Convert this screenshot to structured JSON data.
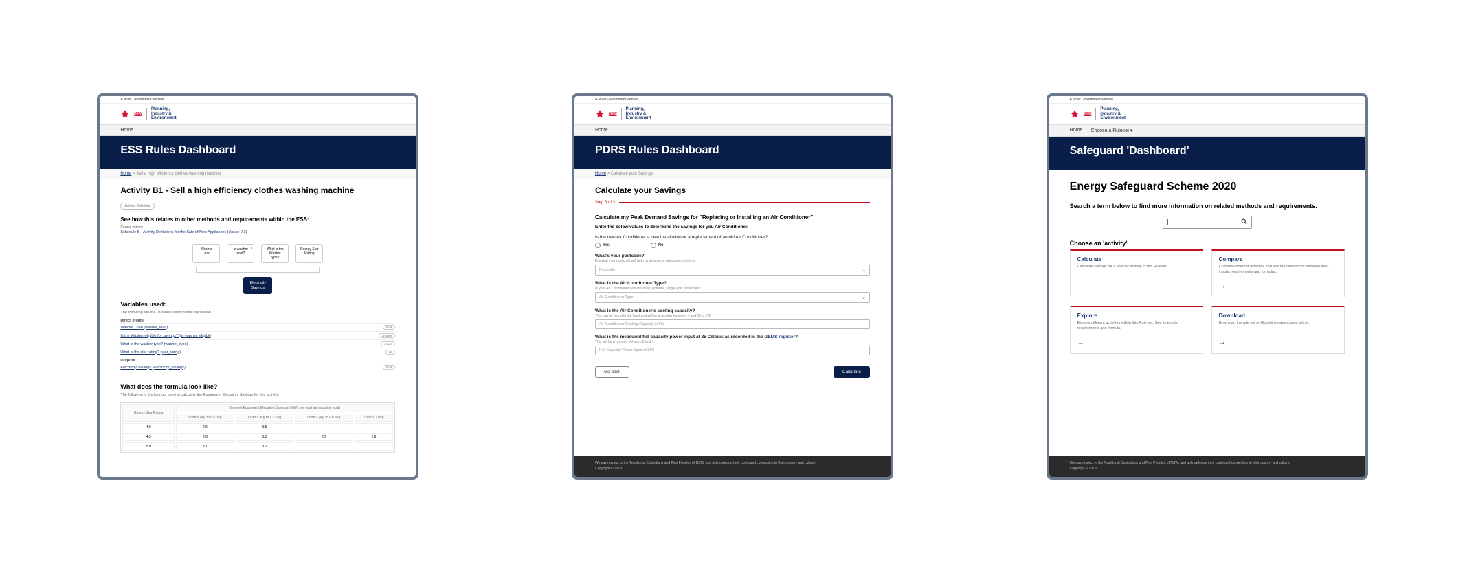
{
  "gov_label": "A NSW Government website",
  "brand_lines": {
    "l1": "Planning,",
    "l2": "Industry &",
    "l3": "Environment"
  },
  "nsw": "NSW",
  "footer": {
    "ack": "We pay respect to the Traditional Custodians and First Peoples of NSW, and acknowledge their continued connection to their country and culture.",
    "copyright": "Copyright © 2019"
  },
  "card1": {
    "nav": {
      "home": "Home"
    },
    "title": "ESS Rules Dashboard",
    "breadcrumb_home": "Home",
    "breadcrumb_sep": " > ",
    "breadcrumb_current": "Sell a high efficiency clothes washing machine",
    "activity_heading": "Activity B1 - Sell a high efficiency clothes washing machine",
    "activity_badge": "Activity Definition",
    "relates": "See how this relates to other methods and requirements within the ESS:",
    "found_within": "Found within:",
    "schedule": "Schedule B - Activity Definitions for the Sale of New Appliances (clause 9.3)",
    "flow": [
      {
        "label": "Washer",
        "sub": "Load"
      },
      {
        "label": "Is washer",
        "sub": "sold?"
      },
      {
        "label": "What is the",
        "sub": "Washer type?"
      },
      {
        "label": "Energy Star",
        "sub": "Rating"
      }
    ],
    "flow_target": "Electricity Savings",
    "vars_heading": "Variables used:",
    "vars_intro": "The following are the variables used in this calculation.",
    "direct_inputs_label": "Direct inputs",
    "direct_inputs": [
      {
        "name": "Washer Load (washer_load)",
        "tag": "float"
      },
      {
        "name": "Is the Washer eligible for savings? (is_washer_eligible)",
        "tag": "answer"
      },
      {
        "name": "What is the washer type? (washer_type)",
        "tag": "enum"
      },
      {
        "name": "What is the star rating? (star_rating)",
        "tag": "int"
      }
    ],
    "outputs_label": "Outputs",
    "outputs": [
      {
        "name": "Electricity Savings (electricity_savings)",
        "tag": "float"
      }
    ],
    "formula_heading": "What does the formula look like?",
    "formula_intro": "The following is the formula used to calculate the Equipment Electricity Savings for this activity.",
    "table": {
      "col1": "Energy Star Rating",
      "col2_header": "Deemed Equipment Electricity Savings (MWh per washing machine sold)",
      "subcols": [
        "Load < 4kg to ≤ 5.0kg",
        "Load > 4kg to ≤ 6.5kg",
        "Load > 4kg to ≤ 6.5kg",
        "Load > 7.0kg"
      ],
      "rows": [
        {
          "r": "4.0",
          "v": [
            "2.6",
            "3.5",
            "",
            ""
          ]
        },
        {
          "r": "4.5",
          "v": [
            "2.8",
            "3.3",
            "2.9",
            "2.9"
          ]
        },
        {
          "r": "5.0",
          "v": [
            "3.1",
            "3.2",
            "",
            ""
          ]
        }
      ]
    }
  },
  "card2": {
    "nav": {
      "home": "Home"
    },
    "title": "PDRS Rules Dashboard",
    "breadcrumb_home": "Home",
    "breadcrumb_sep": " > ",
    "breadcrumb_current": "Calculate your Savings",
    "heading": "Calculate your Savings",
    "step": "Step 3 of 3",
    "calc_heading": "Calculate my Peak Demand Savings for \"Replacing or Installing an Air Conditioner\"",
    "enter_values": "Enter the below values to determine the savings for you Air Conditioner.",
    "q_newinstall": "Is the new Air Conditioner a new installation or a replacement of an old Air Conditioner?",
    "radio_yes": "Yes",
    "radio_no": "No",
    "q_postcode": "What's your postcode?",
    "q_postcode_hint": "Entering your postcode will help us determine what zone you're in.",
    "ph_postcode": "Postcode",
    "q_type": "What is the Air Conditioner Type?",
    "q_type_hint": "Is your Air Conditioner wall-mounted, portable, single-split system etc.",
    "ph_type": "Air Conditioner Type",
    "q_capacity": "What is the Air Conditioner's cooling capacity?",
    "q_capacity_hint": "This can be found in the label and will be a number between 4 and 65 in kW.",
    "ph_capacity": "Air Conditioner Cooling Capacity in kW",
    "q_power": "What is the measured full capacity power input at 35 Celcius as recorded in the ",
    "q_power_link": "GEMS register",
    "q_power_hint": "This will be a number between 0 and 1.",
    "ph_power": "Full Capacity Power Input at 35C",
    "btn_back": "Go back",
    "btn_calc": "Calculate"
  },
  "card3": {
    "nav": {
      "home": "Home",
      "choose": "Choose a Ruleset ▾"
    },
    "title": "Safeguard 'Dashboard'",
    "scheme_heading": "Energy Safeguard Scheme 2020",
    "search_prompt": "Search a term below to find more information on related methods and requirements.",
    "choose_activity": "Choose an 'activity'",
    "tiles": [
      {
        "title": "Calculate",
        "desc": "Calculate savings for a specific activity in this Ruleset."
      },
      {
        "title": "Compare",
        "desc": "Compare different activities and see the differences between their inputs, requirements and formulas."
      },
      {
        "title": "Explore",
        "desc": "Explore different activities within this Rule set. See its inputs, requirements and formula."
      },
      {
        "title": "Download",
        "desc": "Download the rule set or Guidelines associated with it."
      }
    ]
  }
}
